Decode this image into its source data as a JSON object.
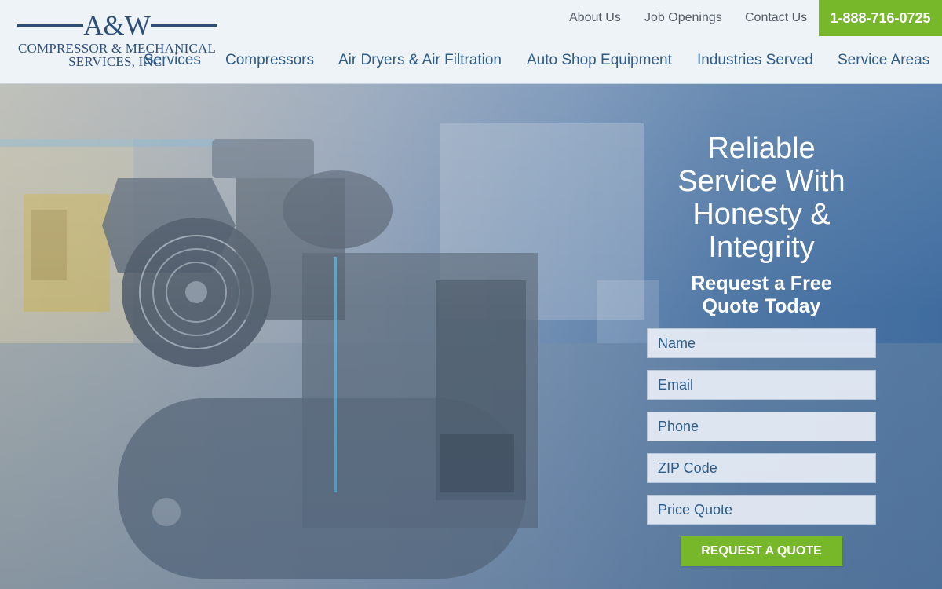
{
  "brand": {
    "mark": "A&W",
    "line2": "COMPRESSOR & MECHANICAL",
    "line3": "SERVICES, INC."
  },
  "utility_nav": {
    "about": "About Us",
    "jobs": "Job Openings",
    "contact": "Contact Us",
    "phone": "1-888-716-0725"
  },
  "main_nav": [
    "Services",
    "Compressors",
    "Air Dryers & Air Filtration",
    "Auto Shop Equipment",
    "Industries Served",
    "Service Areas"
  ],
  "hero": {
    "image": "air-compressor-photo",
    "headline_lines": [
      "Reliable",
      "Service With",
      "Honesty &",
      "Integrity"
    ],
    "subhead_lines": [
      "Request a Free",
      "Quote Today"
    ]
  },
  "quote_form": {
    "name_placeholder": "Name",
    "email_placeholder": "Email",
    "phone_placeholder": "Phone",
    "zip_placeholder": "ZIP Code",
    "quote_placeholder": "Price Quote",
    "submit_label": "REQUEST A QUOTE"
  },
  "colors": {
    "brand_navy": "#2e4e7a",
    "nav_blue": "#2e5b87",
    "accent_green": "#77b82b",
    "hero_blue": "#3f6c9f"
  }
}
